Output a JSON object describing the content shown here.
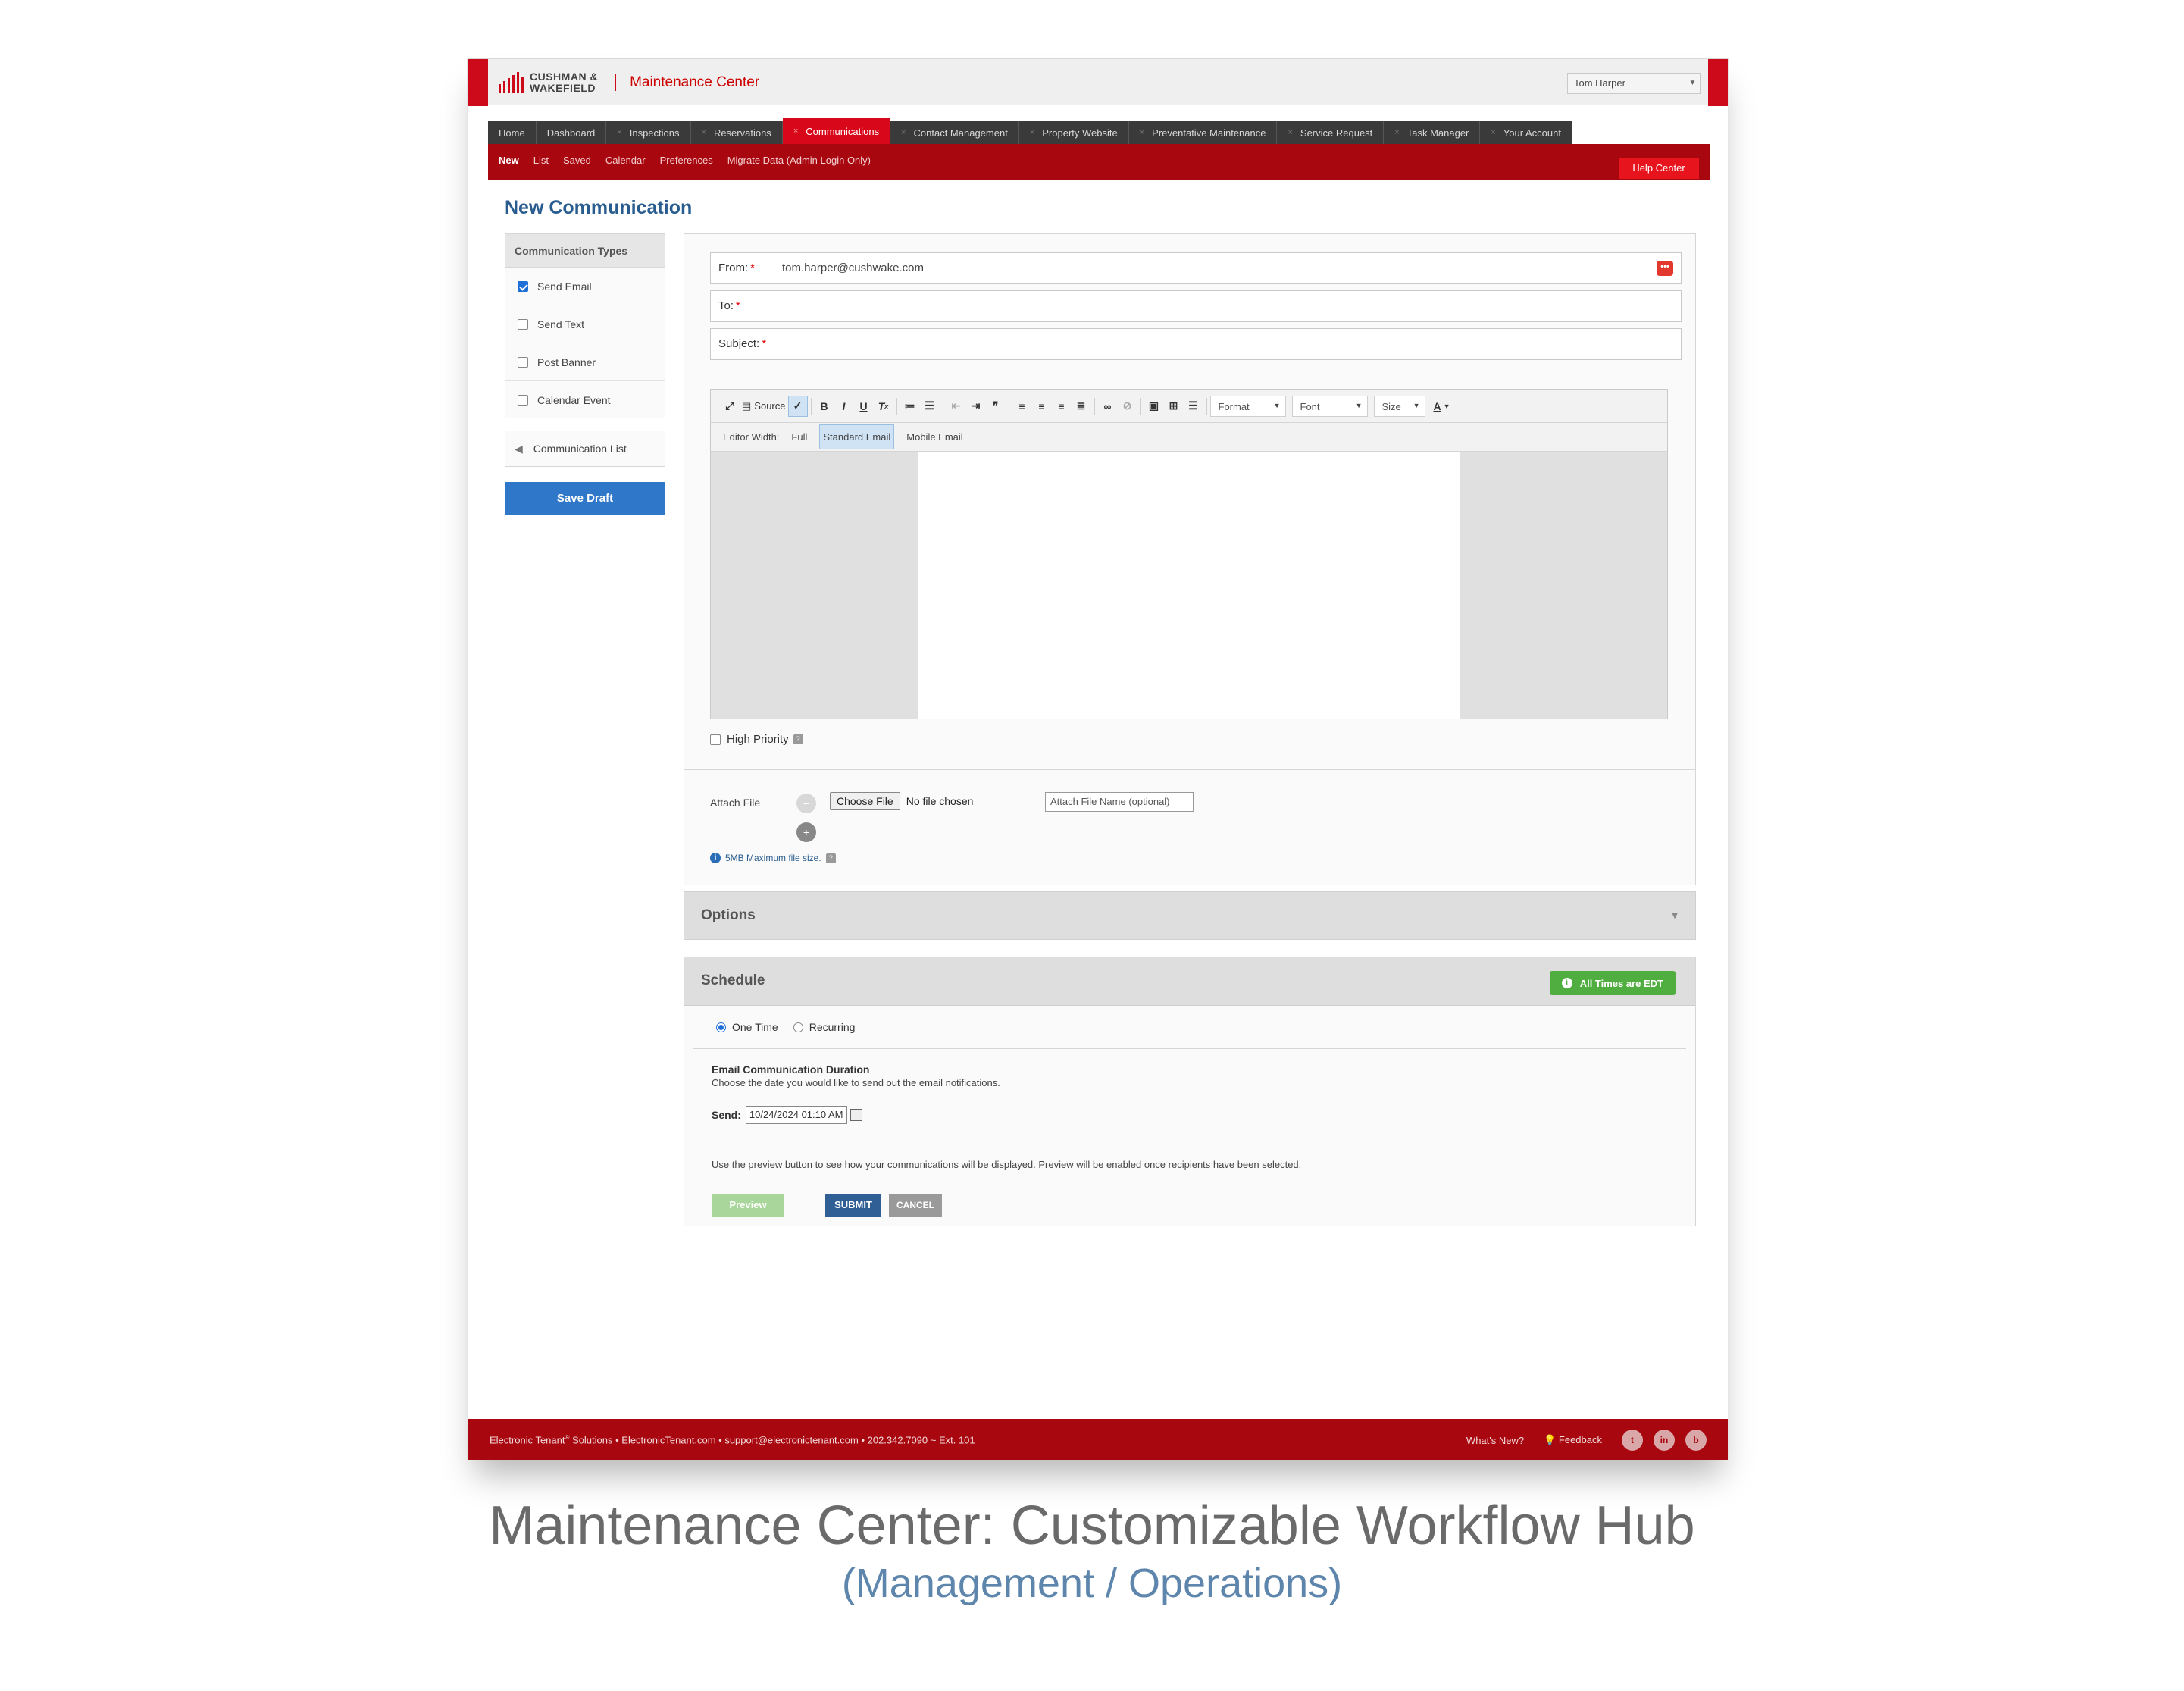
{
  "header": {
    "logo_line1": "CUSHMAN &",
    "logo_line2": "WAKEFIELD",
    "app_title": "Maintenance Center",
    "user": "Tom Harper",
    "brand_color": "#cc0a1a"
  },
  "nav": {
    "items": [
      "Home",
      "Dashboard",
      "Inspections",
      "Reservations",
      "Communications",
      "Contact Management",
      "Property Website",
      "Preventative Maintenance",
      "Service Request",
      "Task Manager",
      "Your Account"
    ],
    "active": "Communications"
  },
  "subnav": {
    "items": [
      "New",
      "List",
      "Saved",
      "Calendar",
      "Preferences",
      "Migrate Data (Admin Login Only)"
    ],
    "active": "New",
    "help": "Help Center"
  },
  "page_title": "New Communication",
  "sidebar": {
    "types_heading": "Communication Types",
    "types": [
      {
        "label": "Send Email",
        "checked": true
      },
      {
        "label": "Send Text",
        "checked": false
      },
      {
        "label": "Post Banner",
        "checked": false
      },
      {
        "label": "Calendar Event",
        "checked": false
      }
    ],
    "comm_list": "Communication List",
    "save_draft": "Save Draft"
  },
  "form": {
    "from_label": "From:",
    "from_value": "tom.harper@cushwake.com",
    "to_label": "To:",
    "subject_label": "Subject:",
    "required_mark": "*"
  },
  "editor": {
    "source": "Source",
    "format": "Format",
    "font": "Font",
    "size": "Size",
    "width_label": "Editor Width:",
    "width_full": "Full",
    "width_standard": "Standard Email",
    "width_mobile": "Mobile Email"
  },
  "high_priority": "High Priority",
  "attach": {
    "label": "Attach File",
    "choose": "Choose File",
    "no_file": "No file chosen",
    "name_placeholder": "Attach File Name (optional)",
    "max_size": "5MB Maximum file size."
  },
  "options_title": "Options",
  "schedule": {
    "title": "Schedule",
    "badge": "All Times are EDT",
    "one_time": "One Time",
    "recurring": "Recurring",
    "duration_title": "Email Communication Duration",
    "duration_sub": "Choose the date you would like to send out the email notifications.",
    "send_label": "Send:",
    "send_value": "10/24/2024 01:10 AM",
    "preview_note": "Use the preview button to see how your communications will be displayed. Preview will be enabled once recipients have been selected.",
    "preview": "Preview",
    "submit": "SUBMIT",
    "cancel": "CANCEL"
  },
  "footer": {
    "brand": "Electronic Tenant",
    "reg": "®",
    "rest": " Solutions • ElectronicTenant.com • support@electronictenant.com • 202.342.7090 ~ Ext. 101",
    "whats_new": "What's New?",
    "feedback": "Feedback"
  },
  "caption": {
    "title": "Maintenance Center: Customizable Workflow Hub",
    "subtitle": "(Management / Operations)"
  }
}
